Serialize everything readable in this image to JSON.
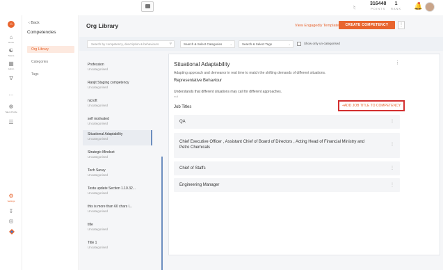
{
  "topbar": {
    "points_value": "316448",
    "points_label": "POINTS",
    "rank_value": "1",
    "rank_label": "RANK"
  },
  "leftnav": {
    "items": [
      {
        "label": "Home",
        "icon": "home-icon"
      },
      {
        "label": "Teams",
        "icon": "teams-icon"
      },
      {
        "label": "Admin",
        "icon": "admin-icon"
      },
      {
        "label": "",
        "icon": "analytics-icon"
      },
      {
        "label": "",
        "icon": "more-icon"
      },
      {
        "label": "Talent Profile",
        "icon": "talent-profile-icon"
      },
      {
        "label": "",
        "icon": "list-icon"
      },
      {
        "label": "Settings",
        "icon": "settings-icon"
      }
    ]
  },
  "sidebar": {
    "back_label": "Back",
    "title": "Competencies",
    "items": [
      {
        "label": "Org Library",
        "active": true
      },
      {
        "label": "Categories",
        "active": false
      },
      {
        "label": "Tags",
        "active": false
      }
    ]
  },
  "header": {
    "title": "Org Library",
    "view_templates": "View Engagedly Templates",
    "create_button": "CREATE COMPETENCY",
    "more_button": "⋮"
  },
  "filters": {
    "search_placeholder": "Search by competency, description & behaviours",
    "categories_placeholder": "Search & Select Categories",
    "tags_placeholder": "Search & Select Tags",
    "uncategorised_label": "Show only un-categorised"
  },
  "competencies": [
    {
      "name": "Profession",
      "category": "Uncategorised"
    },
    {
      "name": "Ranjit Staging competency",
      "category": "Uncategorised"
    },
    {
      "name": "nicroft",
      "category": "Uncategorised"
    },
    {
      "name": "self motivated",
      "category": "Uncategorised"
    },
    {
      "name": "Situational Adaptability",
      "category": "Uncategorised"
    },
    {
      "name": "Strategic Mindset",
      "category": "Uncategorised"
    },
    {
      "name": "Tech Savvy",
      "category": "Uncategorised"
    },
    {
      "name": "Testu update Section 1.10.32...",
      "category": "Uncategorised"
    },
    {
      "name": "this is more than 60 chars l...",
      "category": "Uncategorised"
    },
    {
      "name": "title",
      "category": "Uncategorised"
    },
    {
      "name": "Title 1",
      "category": "Uncategorised"
    }
  ],
  "detail": {
    "title": "Situational Adaptability",
    "description": "Adapting approach and demeanor in real time to match the shifting demands of different situations.",
    "rep_behaviour_heading": "Representative Behaviour",
    "behaviour": "Understands that different situations may call for different approaches.",
    "behaviour_null": "null",
    "job_titles_heading": "Job Titles",
    "add_job_button": "+ADD JOB TITLE TO COMPETENCY",
    "job_titles": [
      "QA",
      "Chief Executive Officer , Assistant Chief of Board of Directors , Acting Head of Financial Ministry and Petro Chemicals",
      "Chief of Staffs",
      "Engineering Manager"
    ]
  },
  "colors": {
    "accent": "#e8652f",
    "highlight_border": "#d32f2f",
    "active_bar": "#6c8ebf"
  }
}
